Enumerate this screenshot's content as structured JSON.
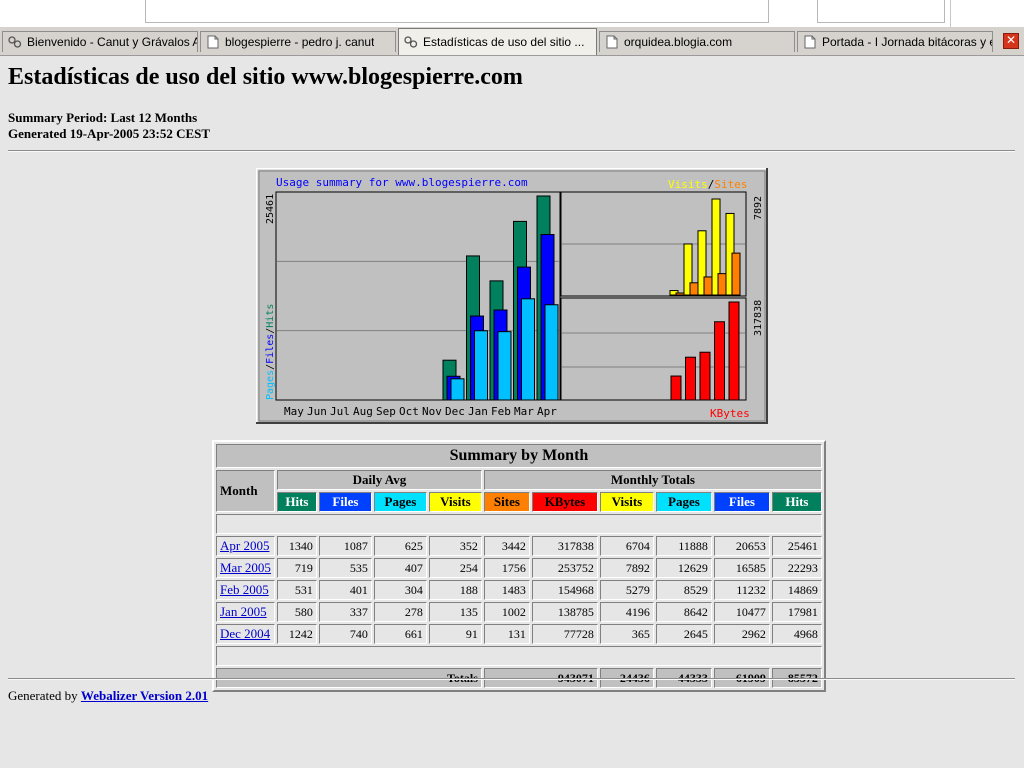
{
  "browser": {
    "tabs": [
      {
        "label": "Bienvenido - Canut y Grávalos A...",
        "icon": "site-favicon-icon",
        "active": false
      },
      {
        "label": "blogespierre - pedro j. canut",
        "icon": "page-icon",
        "active": false
      },
      {
        "label": "Estadísticas de uso del sitio ...",
        "icon": "site-favicon-icon",
        "active": true
      },
      {
        "label": "orquidea.blogia.com",
        "icon": "page-icon",
        "active": false
      },
      {
        "label": "Portada - I Jornada bitácoras y e...",
        "icon": "page-icon",
        "active": false
      }
    ],
    "close_icon": "close-tab-icon"
  },
  "page": {
    "title": "Estadísticas de uso del sitio www.blogespierre.com",
    "summary_period": "Summary Period: Last 12 Months",
    "generated": "Generated 19-Apr-2005 23:52 CEST"
  },
  "chart_data": {
    "type": "bar",
    "title": "Usage summary for www.blogespierre.com",
    "categories": [
      "May",
      "Jun",
      "Jul",
      "Aug",
      "Sep",
      "Oct",
      "Nov",
      "Dec",
      "Jan",
      "Feb",
      "Mar",
      "Apr"
    ],
    "left_panel": {
      "max_label": "25461",
      "axis_label": [
        "Pages",
        "/",
        "Files",
        "/",
        "Hits"
      ],
      "ymax": 25461,
      "series": [
        {
          "name": "Hits",
          "color": "#00805c",
          "values": [
            0,
            0,
            0,
            0,
            0,
            0,
            0,
            4968,
            17981,
            14869,
            22293,
            25461
          ]
        },
        {
          "name": "Files",
          "color": "#0000ff",
          "values": [
            0,
            0,
            0,
            0,
            0,
            0,
            0,
            2962,
            10477,
            11232,
            16585,
            20653
          ]
        },
        {
          "name": "Pages",
          "color": "#00c0ff",
          "values": [
            0,
            0,
            0,
            0,
            0,
            0,
            0,
            2645,
            8642,
            8529,
            12629,
            11888
          ]
        }
      ]
    },
    "right_top_panel": {
      "max_label": "7892",
      "legend": [
        "Visits",
        "/",
        "Sites"
      ],
      "legend_colors": [
        "#ffff00",
        "#000000",
        "#ff8000"
      ],
      "ymax": 7892,
      "series": [
        {
          "name": "Visits",
          "color": "#ffff00",
          "values": [
            365,
            4196,
            5279,
            7892,
            6704
          ]
        },
        {
          "name": "Sites",
          "color": "#ff8000",
          "values": [
            131,
            1002,
            1483,
            1756,
            3442
          ]
        }
      ]
    },
    "right_bottom_panel": {
      "max_label": "317838",
      "legend": "KBytes",
      "ymax": 317838,
      "series": [
        {
          "name": "KBytes",
          "color": "#ff0000",
          "values": [
            77728,
            138785,
            154968,
            253752,
            317838
          ]
        }
      ]
    },
    "grid": true
  },
  "table": {
    "title": "Summary by Month",
    "month_header": "Month",
    "daily_avg_header": "Daily Avg",
    "monthly_totals_header": "Monthly Totals",
    "daily_cols": [
      "Hits",
      "Files",
      "Pages",
      "Visits"
    ],
    "monthly_cols": [
      "Sites",
      "KBytes",
      "Visits",
      "Pages",
      "Files",
      "Hits"
    ],
    "rows": [
      {
        "month": "Apr 2005",
        "d_hits": "1340",
        "d_files": "1087",
        "d_pages": "625",
        "d_visits": "352",
        "sites": "3442",
        "kbytes": "317838",
        "visits": "6704",
        "pages": "11888",
        "files": "20653",
        "hits": "25461"
      },
      {
        "month": "Mar 2005",
        "d_hits": "719",
        "d_files": "535",
        "d_pages": "407",
        "d_visits": "254",
        "sites": "1756",
        "kbytes": "253752",
        "visits": "7892",
        "pages": "12629",
        "files": "16585",
        "hits": "22293"
      },
      {
        "month": "Feb 2005",
        "d_hits": "531",
        "d_files": "401",
        "d_pages": "304",
        "d_visits": "188",
        "sites": "1483",
        "kbytes": "154968",
        "visits": "5279",
        "pages": "8529",
        "files": "11232",
        "hits": "14869"
      },
      {
        "month": "Jan 2005",
        "d_hits": "580",
        "d_files": "337",
        "d_pages": "278",
        "d_visits": "135",
        "sites": "1002",
        "kbytes": "138785",
        "visits": "4196",
        "pages": "8642",
        "files": "10477",
        "hits": "17981"
      },
      {
        "month": "Dec 2004",
        "d_hits": "1242",
        "d_files": "740",
        "d_pages": "661",
        "d_visits": "91",
        "sites": "131",
        "kbytes": "77728",
        "visits": "365",
        "pages": "2645",
        "files": "2962",
        "hits": "4968"
      }
    ],
    "totals": {
      "label": "Totals",
      "kbytes": "943071",
      "visits": "24436",
      "pages": "44333",
      "files": "61909",
      "hits": "85572"
    }
  },
  "footer": {
    "prefix": "Generated by ",
    "link": "Webalizer Version 2.01"
  }
}
